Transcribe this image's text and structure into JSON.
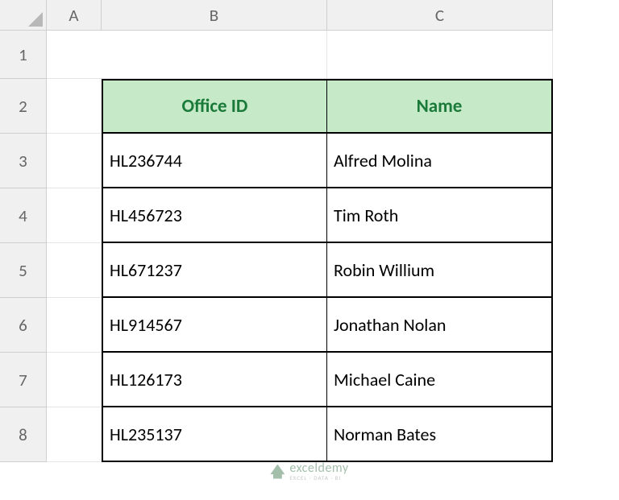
{
  "columns": [
    "A",
    "B",
    "C"
  ],
  "rows": [
    "1",
    "2",
    "3",
    "4",
    "5",
    "6",
    "7",
    "8"
  ],
  "table": {
    "headers": {
      "office_id": "Office ID",
      "name": "Name"
    },
    "data": [
      {
        "office_id": "HL236744",
        "name": "Alfred Molina"
      },
      {
        "office_id": "HL456723",
        "name": "Tim Roth"
      },
      {
        "office_id": "HL671237",
        "name": "Robin Willium"
      },
      {
        "office_id": "HL914567",
        "name": "Jonathan Nolan"
      },
      {
        "office_id": "HL126173",
        "name": "Michael Caine"
      },
      {
        "office_id": "HL235137",
        "name": "Norman Bates"
      }
    ]
  },
  "watermark": {
    "brand": "exceldemy",
    "tagline": "EXCEL · DATA · BI"
  },
  "chart_data": {
    "type": "table",
    "title": "",
    "columns": [
      "Office ID",
      "Name"
    ],
    "rows": [
      [
        "HL236744",
        "Alfred Molina"
      ],
      [
        "HL456723",
        "Tim Roth"
      ],
      [
        "HL671237",
        "Robin Willium"
      ],
      [
        "HL914567",
        "Jonathan Nolan"
      ],
      [
        "HL126173",
        "Michael Caine"
      ],
      [
        "HL235137",
        "Norman Bates"
      ]
    ]
  }
}
